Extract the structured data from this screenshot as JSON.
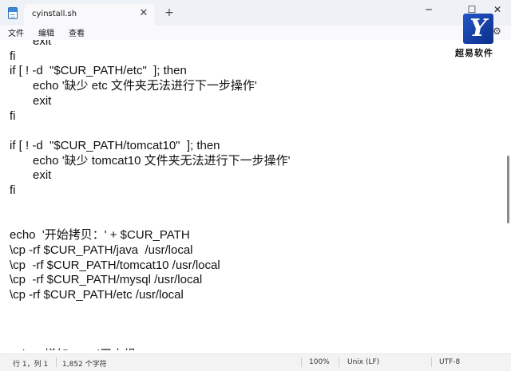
{
  "tab": {
    "title": "cyinstall.sh",
    "close_glyph": "✕",
    "new_tab_glyph": "+"
  },
  "window": {
    "minimize_glyph": "─",
    "maximize_glyph": "☐",
    "close_glyph": "✕"
  },
  "menu": {
    "file": "文件",
    "edit": "编辑",
    "view": "查看",
    "settings_glyph": "⚙"
  },
  "brand": {
    "logo_letter": "Y",
    "name": "超易软件"
  },
  "code_lines": [
    "exit",
    "fi",
    "if [ ! -d  \"$CUR_PATH/etc\"  ]; then",
    "echo '缺少 etc 文件夹无法进行下一步操作'",
    "exit",
    "fi",
    "",
    "if [ ! -d  \"$CUR_PATH/tomcat10\"  ]; then",
    "echo '缺少 tomcat10 文件夹无法进行下一步操作'",
    "exit",
    "fi",
    "",
    "",
    "echo  '开始拷贝：' + $CUR_PATH",
    "\\cp -rf $CUR_PATH/java  /usr/local",
    "\\cp  -rf $CUR_PATH/tomcat10 /usr/local",
    "\\cp  -rf $CUR_PATH/mysql /usr/local",
    "\\cp -rf $CUR_PATH/etc /usr/local",
    "",
    "",
    "",
    "echo  '增加mysql用户组'"
  ],
  "status": {
    "position": "行 1，列 1",
    "char_count": "1,852 个字符",
    "zoom": "100%",
    "line_ending": "Unix (LF)",
    "encoding": "UTF-8"
  }
}
